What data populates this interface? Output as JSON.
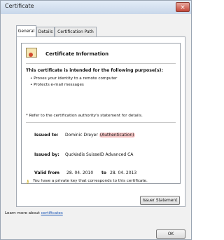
{
  "window": {
    "title": "Certificate",
    "close_glyph": "×"
  },
  "tabs": [
    {
      "label": "General"
    },
    {
      "label": "Details"
    },
    {
      "label": "Certification Path"
    }
  ],
  "info": {
    "title": "Certificate Information",
    "purpose_header": "This certificate is intended for the following purpose(s):",
    "purposes": [
      "• Proves your identity to a remote computer",
      "• Protects e-mail messages"
    ],
    "refer_note": "* Refer to the certification authority's statement for details.",
    "issued_to_label": "Issued to:",
    "issued_to_name": "Dominic Dreyer",
    "issued_to_tag": "(Authentication)",
    "issued_by_label": "Issued by:",
    "issued_by_value": "QuoVadis SuisseID Advanced CA",
    "valid_from_label": "Valid from",
    "valid_from_value": "28. 04. 2010",
    "valid_to_label": "to",
    "valid_to_value": "28. 04. 2013",
    "private_key_note": "You have a private key that corresponds to this certificate."
  },
  "buttons": {
    "issuer_statement": "Issuer Statement",
    "ok": "OK"
  },
  "learn": {
    "prefix": "Learn more about ",
    "link": "certificates"
  },
  "icons": {
    "certificate": "certificate-icon",
    "key": "key-icon"
  }
}
